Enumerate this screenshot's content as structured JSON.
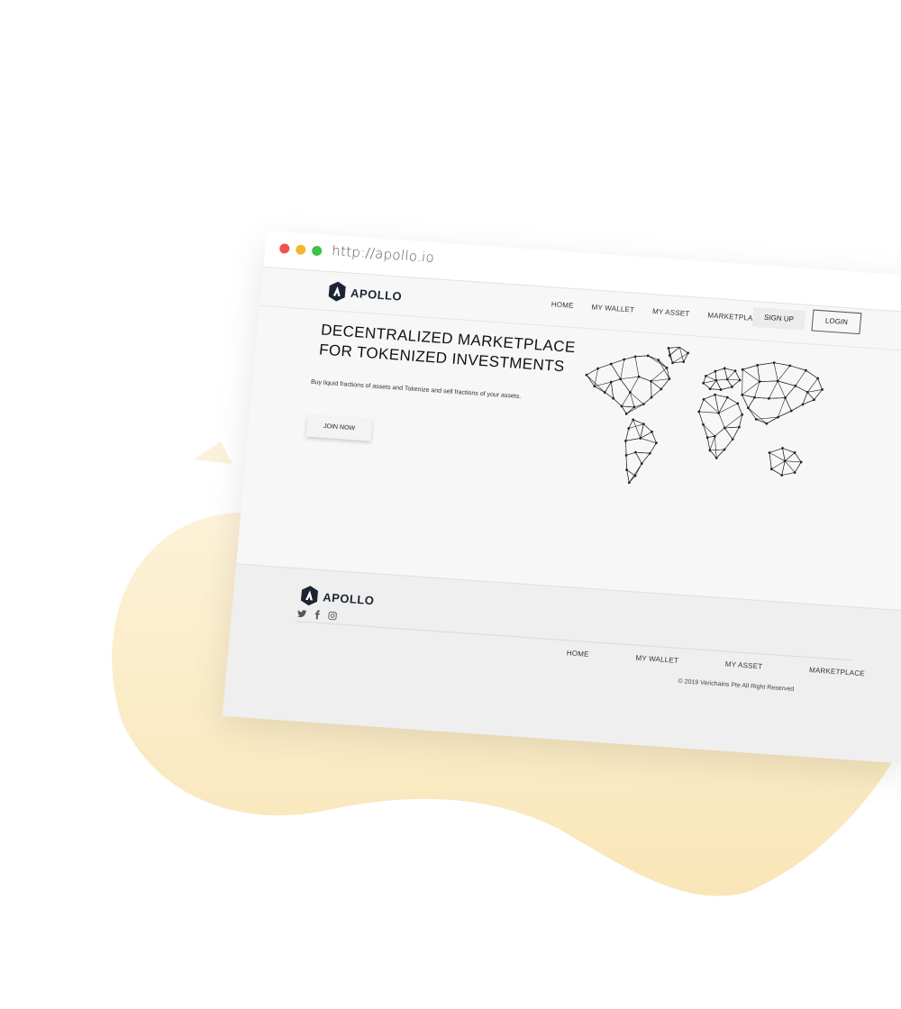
{
  "browser": {
    "url": "http://apollo.io"
  },
  "brand": {
    "name": "APOLLO",
    "dark": "#1c2433",
    "blob_color": "#fbecc6"
  },
  "header": {
    "nav": [
      "HOME",
      "MY WALLET",
      "MY ASSET",
      "MARKETPLACE"
    ],
    "signup_label": "SIGN UP",
    "login_label": "LOGIN"
  },
  "hero": {
    "title_line1": "DECENTRALIZED MARKETPLACE",
    "title_line2": "FOR TOKENIZED INVESTMENTS",
    "subtitle": "Buy liquid fractions of assets and Tokenize and sell fractions of your assets.",
    "join_label": "JOIN NOW"
  },
  "footer": {
    "social_icons": [
      "twitter-icon",
      "facebook-icon",
      "instagram-icon"
    ],
    "nav": [
      "HOME",
      "MY WALLET",
      "MY ASSET",
      "MARKETPLACE"
    ],
    "copyright": "© 2019 Verichains Pte All Right Reserved"
  }
}
